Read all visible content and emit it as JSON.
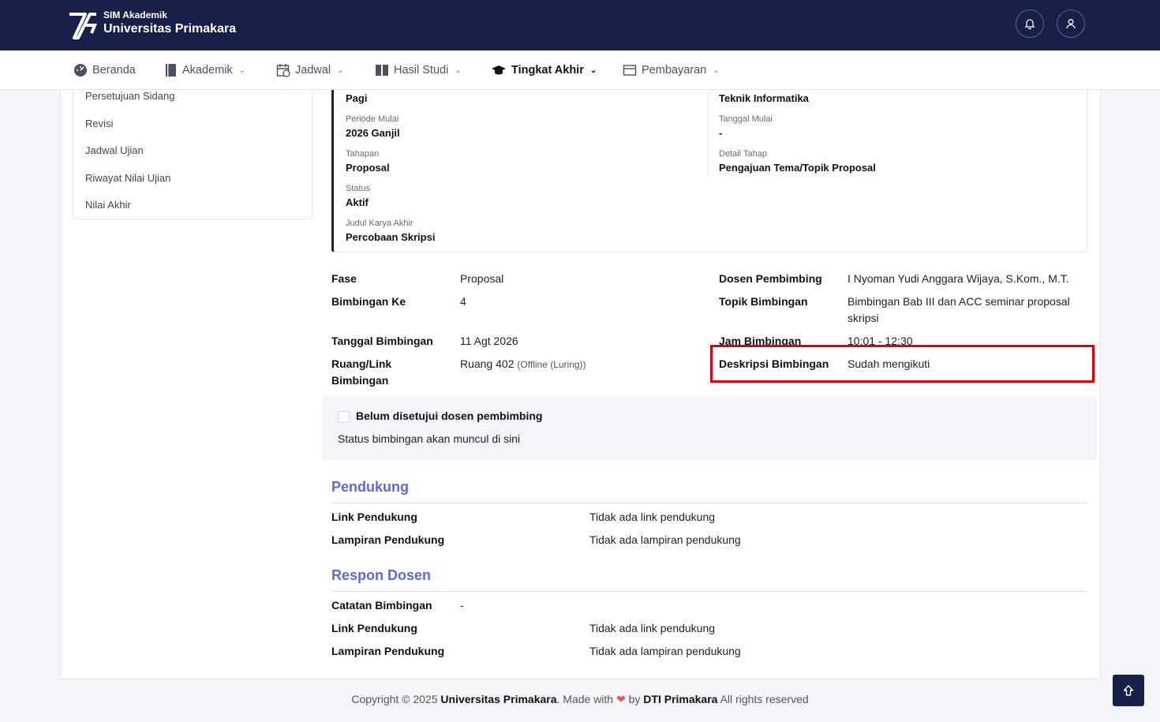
{
  "header": {
    "brand_sub": "SIM Akademik",
    "brand_main": "Universitas Primakara"
  },
  "nav": {
    "items": [
      {
        "label": "Beranda",
        "icon": "dashboard-icon"
      },
      {
        "label": "Akademik",
        "icon": "book-icon"
      },
      {
        "label": "Jadwal",
        "icon": "calendar-icon"
      },
      {
        "label": "Hasil Studi",
        "icon": "book-open-icon"
      },
      {
        "label": "Tingkat Akhir",
        "icon": "graduation-cap-icon"
      },
      {
        "label": "Pembayaran",
        "icon": "wallet-icon"
      }
    ]
  },
  "sidebar": {
    "items": [
      {
        "label": "Persetujuan Sidang"
      },
      {
        "label": "Revisi"
      },
      {
        "label": "Jadwal Ujian"
      },
      {
        "label": "Riwayat Nilai Ujian"
      },
      {
        "label": "Nilai Akhir"
      }
    ]
  },
  "info": {
    "kelas_value": "Pagi",
    "prodi_value": "Teknik Informatika",
    "periode_label": "Periode Mulai",
    "periode_value": "2026 Ganjil",
    "tanggal_mulai_label": "Tanggal Mulai",
    "tanggal_mulai_value": "-",
    "tahapan_label": "Tahapan",
    "tahapan_value": "Proposal",
    "detail_tahap_label": "Detail Tahap",
    "detail_tahap_value": "Pengajuan Tema/Topik Proposal",
    "status_label": "Status",
    "status_value": "Aktif",
    "judul_label": "Judul Karya Akhir",
    "judul_value": "Percobaan Skripsi"
  },
  "detail": {
    "fase_label": "Fase",
    "fase_value": "Proposal",
    "bimbingan_ke_label": "Bimbingan Ke",
    "bimbingan_ke_value": "4",
    "tanggal_label": "Tanggal Bimbingan",
    "tanggal_value": "11 Agt 2026",
    "ruang_label": "Ruang/Link Bimbingan",
    "ruang_value": "Ruang 402",
    "ruang_mode": "(Offline (Luring))",
    "dosen_label": "Dosen Pembimbing",
    "dosen_value": "I Nyoman Yudi Anggara Wijaya, S.Kom., M.T.",
    "topik_label": "Topik Bimbingan",
    "topik_value": "Bimbingan Bab III dan ACC seminar proposal skripsi",
    "jam_label": "Jam Bimbingan",
    "jam_value": "10:01 - 12:30",
    "deskripsi_label": "Deskripsi Bimbingan",
    "deskripsi_value": "Sudah mengikuti"
  },
  "status": {
    "checkbox_label": "Belum disetujui dosen pembimbing",
    "note": "Status bimbingan akan muncul di sini"
  },
  "pendukung": {
    "title": "Pendukung",
    "link_label": "Link Pendukung",
    "link_value": "Tidak ada link pendukung",
    "lampiran_label": "Lampiran Pendukung",
    "lampiran_value": "Tidak ada lampiran pendukung"
  },
  "respon": {
    "title": "Respon Dosen",
    "catatan_label": "Catatan Bimbingan",
    "catatan_value": "-",
    "link_label": "Link Pendukung",
    "link_value": "Tidak ada link pendukung",
    "lampiran_label": "Lampiran Pendukung",
    "lampiran_value": "Tidak ada lampiran pendukung"
  },
  "footer": {
    "copyright": "Copyright © 2025",
    "org": "Universitas Primakara",
    "made_with": ". Made with",
    "by": "by",
    "team": "DTI Primakara",
    "rights": "All rights reserved"
  },
  "colors": {
    "header_bg": "#181f48",
    "section_title": "#5a6bdc",
    "highlight": "#e0000f"
  }
}
